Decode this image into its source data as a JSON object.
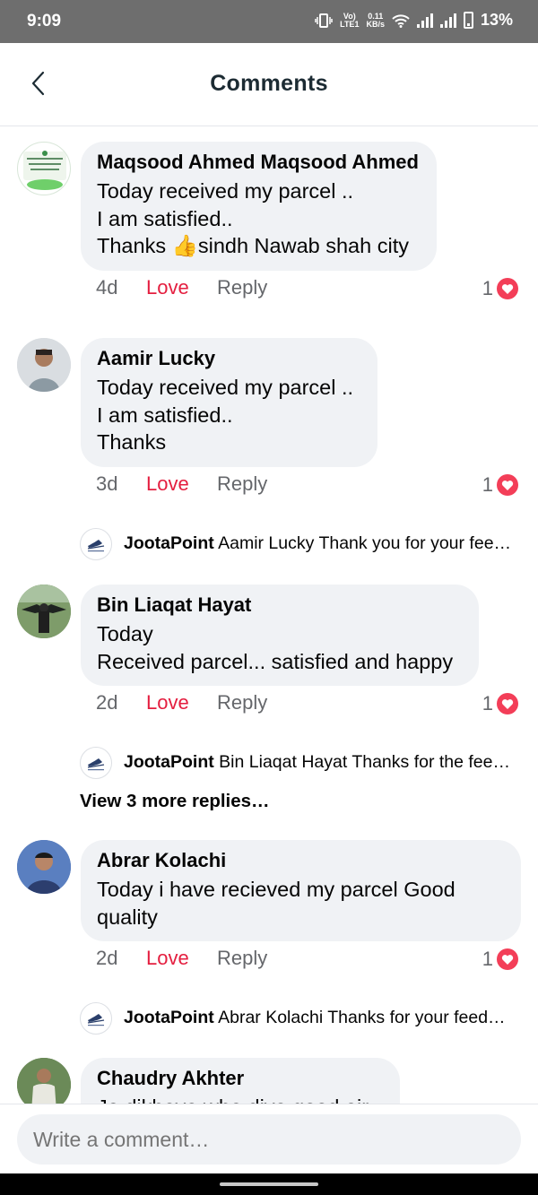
{
  "status_bar": {
    "time": "9:09",
    "network_label_top": "Vo)",
    "network_label_bottom": "LTE1",
    "speed_value": "0.11",
    "speed_unit": "KB/s",
    "battery": "13%"
  },
  "header": {
    "title": "Comments"
  },
  "comments": [
    {
      "name": "Maqsood Ahmed Maqsood Ahmed",
      "lines": [
        "Today received my parcel ..",
        "I am satisfied..",
        "Thanks 👍sindh Nawab shah city"
      ],
      "time": "4d",
      "love": "Love",
      "reply": "Reply",
      "reactions": "1"
    },
    {
      "name": "Aamir Lucky",
      "lines": [
        "Today received my parcel ..",
        "I am satisfied..",
        "Thanks"
      ],
      "time": "3d",
      "love": "Love",
      "reply": "Reply",
      "reactions": "1",
      "page_reply": {
        "author": "JootaPoint",
        "text": "Aamir Lucky Thank you for your fee…"
      }
    },
    {
      "name": "Bin Liaqat Hayat",
      "lines": [
        "Today",
        "Received parcel... satisfied and happy"
      ],
      "time": "2d",
      "love": "Love",
      "reply": "Reply",
      "reactions": "1",
      "page_reply": {
        "author": "JootaPoint",
        "text": "Bin Liaqat Hayat Thanks for the fee…"
      },
      "view_more": "View 3 more replies…"
    },
    {
      "name": "Abrar Kolachi",
      "lines": [
        "Today i have recieved my parcel Good",
        "quality"
      ],
      "time": "2d",
      "love": "Love",
      "reply": "Reply",
      "reactions": "1",
      "page_reply": {
        "author": "JootaPoint",
        "text": "Abrar Kolachi Thanks for your feed…"
      }
    },
    {
      "name": "Chaudry Akhter",
      "lines": [
        "Jo dikhaya wha diya good air"
      ]
    }
  ],
  "composer": {
    "placeholder": "Write a comment…"
  },
  "colors": {
    "love": "#e41e3f",
    "bubble": "#f0f2f5",
    "heart": "#f33e58",
    "statusbar": "#6e6e6e"
  },
  "icons": [
    "back-chevron-icon",
    "vibrate-icon",
    "wifi-icon",
    "signal-icon",
    "battery-icon",
    "heart-icon",
    "jootapoint-logo-icon"
  ]
}
